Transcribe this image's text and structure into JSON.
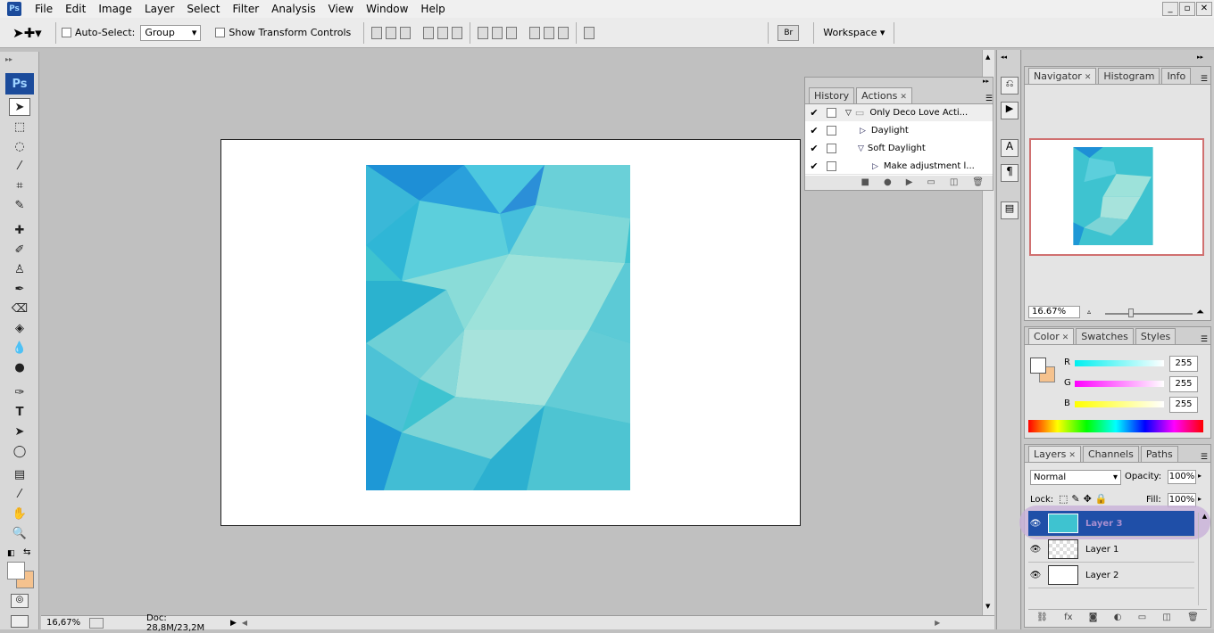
{
  "app": {
    "logo": "Ps"
  },
  "menu": [
    "File",
    "Edit",
    "Image",
    "Layer",
    "Select",
    "Filter",
    "Analysis",
    "View",
    "Window",
    "Help"
  ],
  "window_controls": {
    "minimize": "_",
    "restore": "▫",
    "close": "✕"
  },
  "options_bar": {
    "auto_select_label": "Auto-Select:",
    "auto_select_value": "Group",
    "show_transform_label": "Show Transform Controls",
    "workspace_label": "Workspace"
  },
  "status": {
    "zoom": "16,67%",
    "doc": "Doc: 28,8M/23,2M"
  },
  "actions_panel": {
    "tabs": [
      "History",
      "Actions"
    ],
    "items": [
      "Only Deco Love Acti...",
      "Daylight",
      "Soft Daylight",
      "Make adjustment l..."
    ]
  },
  "navigator": {
    "tabs": [
      "Navigator",
      "Histogram",
      "Info"
    ],
    "zoom": "16.67%"
  },
  "color": {
    "tabs": [
      "Color",
      "Swatches",
      "Styles"
    ],
    "channels": [
      {
        "label": "R",
        "value": "255"
      },
      {
        "label": "G",
        "value": "255"
      },
      {
        "label": "B",
        "value": "255"
      }
    ]
  },
  "layers": {
    "tabs": [
      "Layers",
      "Channels",
      "Paths"
    ],
    "blend_mode": "Normal",
    "opacity_label": "Opacity:",
    "opacity": "100%",
    "lock_label": "Lock:",
    "fill_label": "Fill:",
    "fill": "100%",
    "items": [
      "Layer 3",
      "Layer 1",
      "Layer 2"
    ]
  },
  "colors": {
    "highlight": "#1f4fa8",
    "teal": "#3ec3d0",
    "accent_border": "#d07070"
  }
}
